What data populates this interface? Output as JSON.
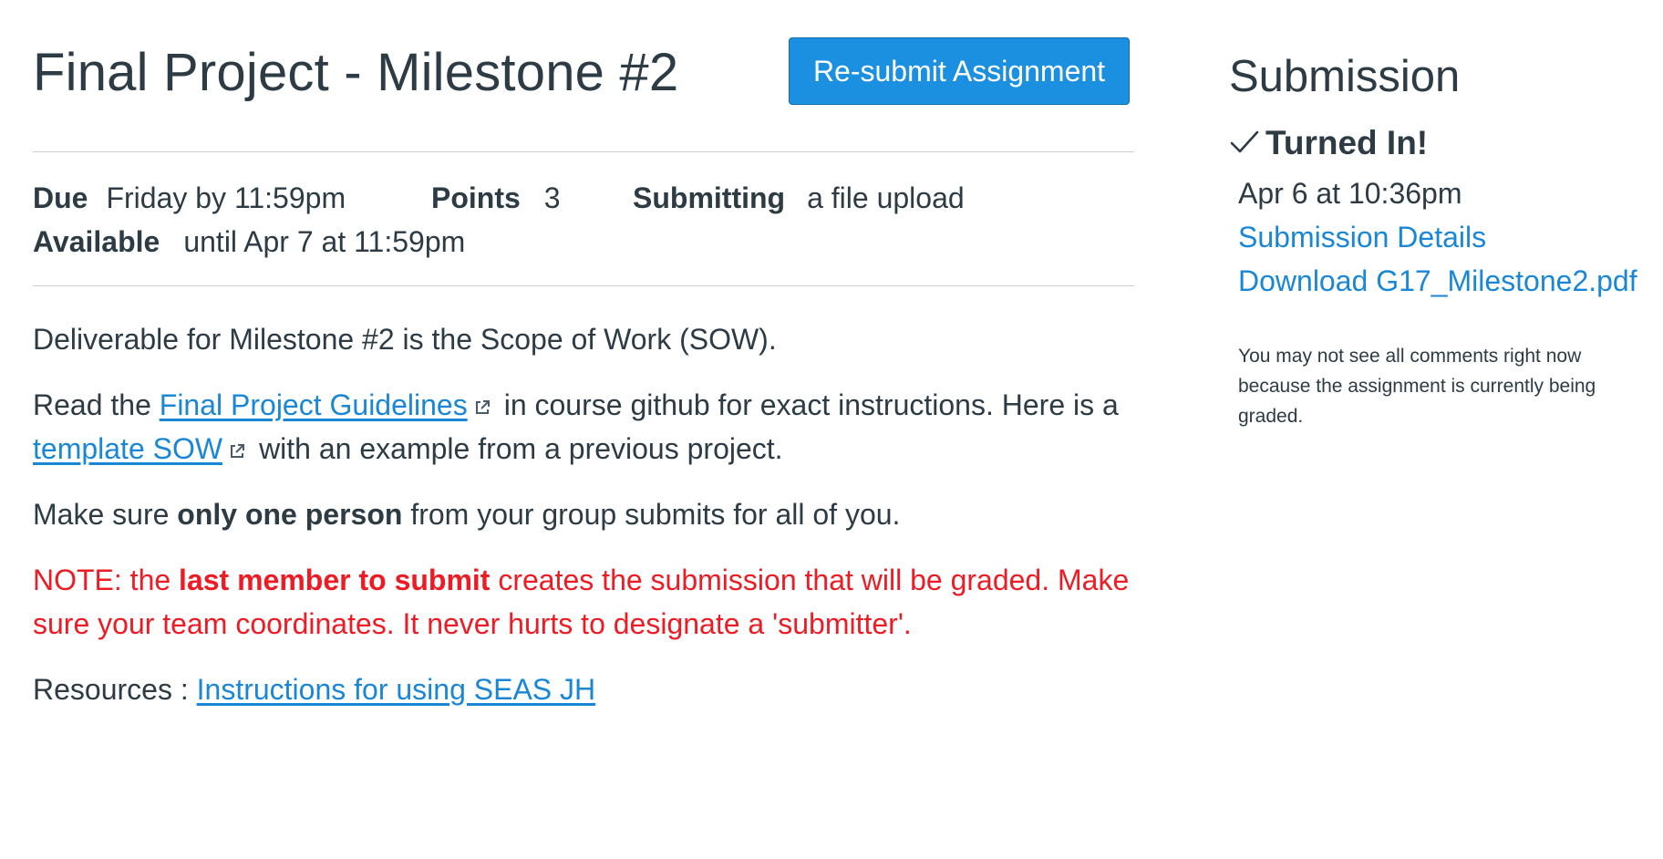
{
  "assignment": {
    "title": "Final Project - Milestone #2",
    "resubmit_label": "Re-submit Assignment",
    "meta": {
      "due_label": "Due",
      "due_value": "Friday by 11:59pm",
      "points_label": "Points",
      "points_value": "3",
      "submitting_label": "Submitting",
      "submitting_value": "a file upload",
      "available_label": "Available",
      "available_value": "until Apr 7 at 11:59pm"
    },
    "description": {
      "p1": "Deliverable for Milestone #2 is the Scope of Work (SOW).",
      "p2_pre": "Read the ",
      "p2_link1": "Final Project Guidelines",
      "p2_mid": "in course github for exact instructions. Here is a ",
      "p2_link2": "template SOW",
      "p2_post": "with an example from a previous project.",
      "p3_pre": "Make sure ",
      "p3_bold": "only one person",
      "p3_post": " from your group submits for all of you.",
      "p4_pre": "NOTE: the ",
      "p4_bold": "last member to submit",
      "p4_post": " creates the submission that will be graded. Make sure your team coordinates. It never hurts to designate a 'submitter'.",
      "p5_pre": "Resources : ",
      "p5_link": "Instructions for using SEAS JH"
    }
  },
  "sidebar": {
    "title": "Submission",
    "status": "Turned In!",
    "submitted_at": "Apr 6 at 10:36pm",
    "details_link": "Submission Details",
    "download_link": "Download G17_Milestone2.pdf",
    "note": "You may not see all comments right now because the assignment is currently being graded."
  },
  "colors": {
    "accent": "#1b8fe0",
    "link": "#1a87d6",
    "text": "#2d3b45",
    "warning": "#ed1c24",
    "divider": "#c7cdd1"
  },
  "icons": [
    "external-link-icon",
    "checkmark-icon"
  ]
}
